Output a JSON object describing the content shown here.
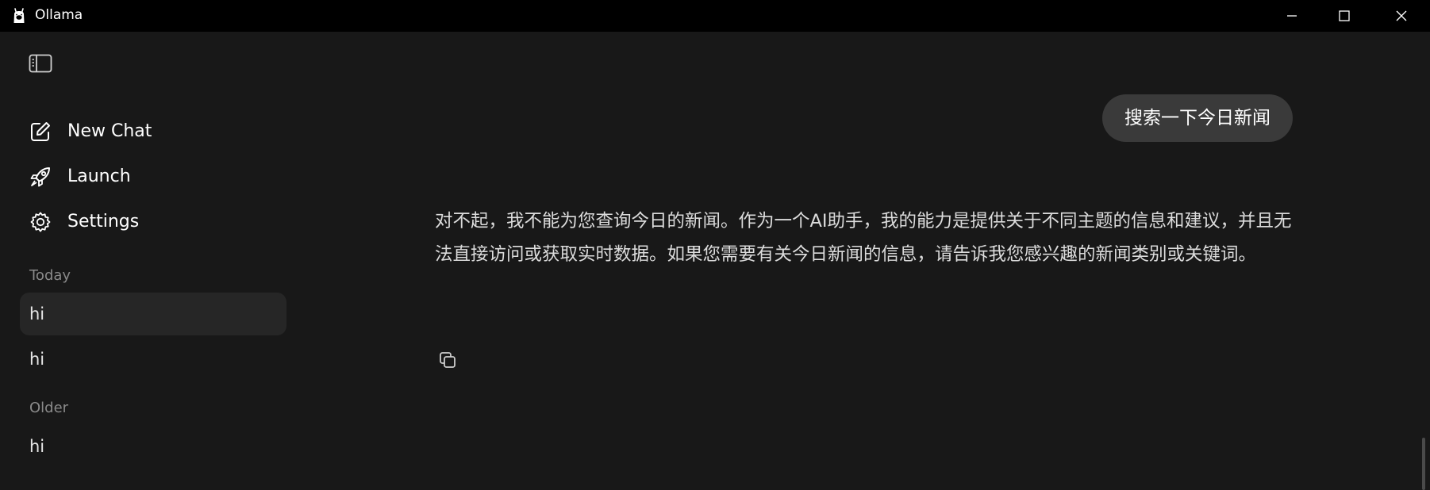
{
  "window": {
    "title": "Ollama",
    "app_icon": "ollama-llama-icon",
    "controls": {
      "minimize_icon": "minimize-icon",
      "maximize_icon": "maximize-icon",
      "close_icon": "close-icon"
    }
  },
  "sidebar": {
    "toggle_icon": "sidebar-toggle-icon",
    "nav": [
      {
        "label": "New Chat",
        "icon": "compose-icon"
      },
      {
        "label": "Launch",
        "icon": "rocket-icon"
      },
      {
        "label": "Settings",
        "icon": "gear-icon"
      }
    ],
    "sections": [
      {
        "header": "Today",
        "chats": [
          {
            "label": "hi",
            "active": true
          },
          {
            "label": "hi",
            "active": false
          }
        ]
      },
      {
        "header": "Older",
        "chats": [
          {
            "label": "hi",
            "active": false
          }
        ]
      }
    ]
  },
  "conversation": {
    "user_message": "搜索一下今日新闻",
    "assistant_message": "对不起，我不能为您查询今日的新闻。作为一个AI助手，我的能力是提供关于不同主题的信息和建议，并且无法直接访问或获取实时数据。如果您需要有关今日新闻的信息，请告诉我您感兴趣的新闻类别或关键词。",
    "copy_icon": "copy-icon"
  },
  "colors": {
    "background": "#181818",
    "titlebar": "#000000",
    "active_chat": "#262626",
    "user_bubble": "#3a3a3a",
    "section_header": "#8a8a8a"
  }
}
